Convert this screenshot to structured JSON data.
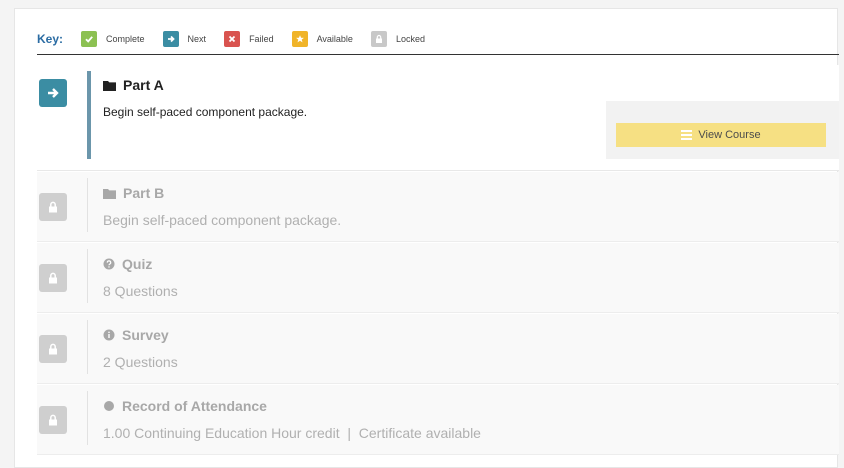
{
  "key": {
    "title": "Key:",
    "items": [
      {
        "label": "Complete",
        "icon": "check-icon",
        "color": "#8cc152"
      },
      {
        "label": "Next",
        "icon": "arrow-right-icon",
        "color": "#3b8da3"
      },
      {
        "label": "Failed",
        "icon": "x-icon",
        "color": "#d9534f"
      },
      {
        "label": "Available",
        "icon": "star-icon",
        "color": "#f0b429"
      },
      {
        "label": "Locked",
        "icon": "lock-icon",
        "color": "#c8c8c8"
      }
    ]
  },
  "items": [
    {
      "title": "Part A",
      "description": "Begin self-paced component package.",
      "status": "next",
      "icon": "folder-icon"
    },
    {
      "title": "Part B",
      "description": "Begin self-paced component package.",
      "status": "locked",
      "icon": "folder-icon"
    },
    {
      "title": "Quiz",
      "description": "8 Questions",
      "status": "locked",
      "icon": "question-circle-icon"
    },
    {
      "title": "Survey",
      "description": "2 Questions",
      "status": "locked",
      "icon": "info-circle-icon"
    },
    {
      "title": "Record of Attendance",
      "description": "1.00 Continuing Education Hour credit  |  Certificate available",
      "status": "locked",
      "icon": "circle-icon"
    }
  ],
  "view_course": {
    "label": "View Course",
    "icon": "list-icon"
  },
  "colors": {
    "accent": "#3b8da3",
    "button": "#f6e083",
    "locked": "#cfcfcf"
  }
}
